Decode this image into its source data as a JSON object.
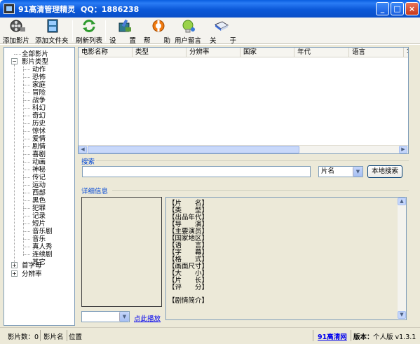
{
  "window": {
    "title": "91高清管理精灵",
    "qq": "QQ：1886238",
    "min_glyph": "_",
    "max_glyph": "□",
    "close_glyph": "×"
  },
  "toolbar": {
    "add_movie": "添加影片",
    "add_folder": "添加文件夹",
    "refresh": "刷新列表",
    "settings": "设　　置",
    "help": "帮　　助",
    "feedback": "用户留言",
    "about": "关　　于"
  },
  "tree": {
    "all": "全部影片",
    "types": "影片类型",
    "genres": [
      "动作",
      "恐怖",
      "家庭",
      "冒险",
      "战争",
      "科幻",
      "奇幻",
      "历史",
      "惊怵",
      "爱情",
      "剧情",
      "喜剧",
      "动画",
      "神秘",
      "传记",
      "运动",
      "西部",
      "黑色",
      "犯罪",
      "记录",
      "短片",
      "音乐剧",
      "音乐",
      "真人秀",
      "连续剧",
      "其它"
    ],
    "initial": "首字母",
    "resolution": "分辨率",
    "plus": "+",
    "minus": "−"
  },
  "list": {
    "columns": [
      "电影名称",
      "类型",
      "分辨率",
      "国家",
      "年代",
      "语言",
      "字"
    ]
  },
  "search": {
    "group_title": "搜索",
    "input_value": "",
    "field_select": "片名",
    "button": "本地搜索"
  },
  "detail": {
    "group_title": "详细信息",
    "fields": [
      "【片　　名】",
      "【类　　型】",
      "【出品年代】",
      "【导　　演】",
      "【主要演员】",
      "【国家地区】",
      "【语　　言】",
      "【字　　幕】",
      "【格　　式】",
      "【画面尺寸】",
      "【大　　小】",
      "【片　　长】",
      "【评　　分】"
    ],
    "synopsis": "【剧情简介】",
    "play_link": "点此播放",
    "file_select": ""
  },
  "status": {
    "count_label": "影片数：0",
    "name_label": "影片名",
    "location_label": "位置",
    "site_link": "91高清网",
    "version_label": "版本：",
    "version_value": "个人版 v1.3.1"
  },
  "colors": {
    "titlebar": "#0a58d8",
    "group_title": "#0046d5",
    "link": "#0000ee"
  }
}
